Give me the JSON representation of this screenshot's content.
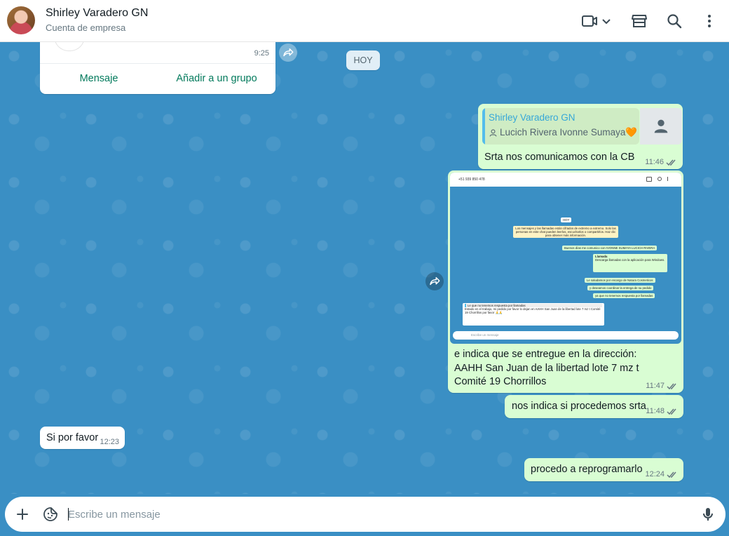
{
  "header": {
    "contact_name": "Shirley Varadero GN",
    "contact_subtitle": "Cuenta de empresa"
  },
  "contact_card": {
    "time": "9:25",
    "actions": [
      "Mensaje",
      "Añadir a un grupo"
    ]
  },
  "date_divider": "HOY",
  "messages": [
    {
      "direction": "out",
      "quote_author": "Shirley Varadero GN",
      "quote_text": "Lucich Rivera Ivonne Sumaya🧡",
      "text": "Srta nos comunicamos con la CB",
      "time": "11:46"
    },
    {
      "direction": "out",
      "image_caption": "e indica que se entregue en la dirección:  AAHH San Juan de la libertad lote 7 mz t Comité 19 Chorrillos",
      "time": "11:47",
      "screenshot": {
        "phone": "+51 939 850 478",
        "day": "HOY",
        "notice": "Los mensajes y las llamadas están cifrados de extremo a extremo. Solo las personas en este chat pueden leerlos, escucharlos o compartirlos. Haz clic para obtener más información.",
        "lines": [
          "Buenos días me comunico con IVONNE SUMAYA LUCICH RIVERA",
          "Llamada",
          "Descarga llamadas con la aplicación para Windows.",
          "Le saludamos por encargo de Natura Cosmeticos",
          "y deseamos coordinar la entrega de su pedido",
          "ya que no tenemos respuesta por llamadas"
        ],
        "reply_quote": "Le que no tenemos respuesta por llamadas",
        "reply_text": "Estado en el trabajo, mi pedido por favor lo dejan en AAHH San Juan de la libertad lote 7 mz t Comité 19 Chorrillos por favor 🙏🙏",
        "input_placeholder": "Escribe un mensaje"
      }
    },
    {
      "direction": "out",
      "text": "nos indica si procedemos srta",
      "time": "11:48"
    },
    {
      "direction": "in",
      "text": "Si por favor",
      "time": "12:23"
    },
    {
      "direction": "out",
      "text": "procedo a reprogramarlo",
      "time": "12:24"
    }
  ],
  "composer": {
    "placeholder": "Escribe un mensaje"
  },
  "colors": {
    "chat_bg": "#3a8fc4",
    "outgoing_bubble": "#d9fdd3",
    "incoming_bubble": "#ffffff",
    "accent_green": "#027a5c",
    "quote_author": "#35a7d8"
  }
}
